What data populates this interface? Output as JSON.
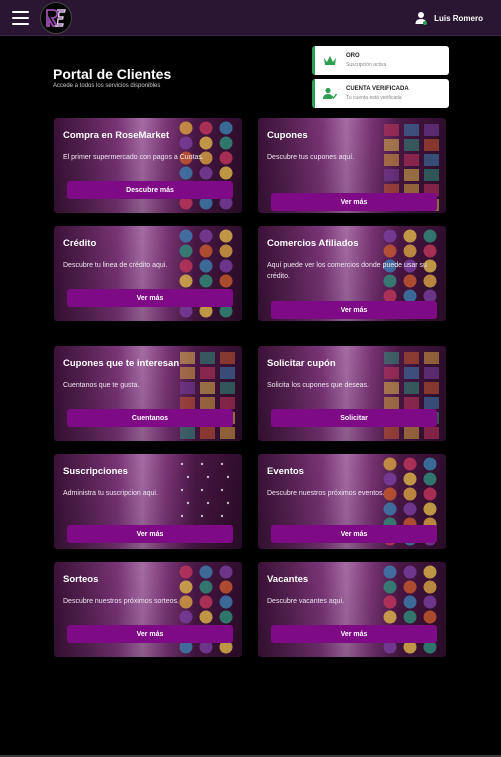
{
  "header": {
    "user_name": "Luis Romero",
    "logo_text": "RE"
  },
  "page": {
    "title": "Portal de Clientes",
    "subtitle": "Accede a todos los servicios disponibles"
  },
  "status": [
    {
      "label": "ORO",
      "sub": "Suscripción activa",
      "icon": "crown-icon"
    },
    {
      "label": "CUENTA VERIFICADA",
      "sub": "Tu cuenta está verificada",
      "icon": "verified-user-icon"
    }
  ],
  "cards": [
    {
      "title": "Compra en RoseMarket",
      "desc": "El primer supermercado con pagos a Cuotas.",
      "button": "Descubre más"
    },
    {
      "title": "Cupones",
      "desc": "Descubre tus cupones aquí.",
      "button": "Ver más"
    },
    {
      "title": "Crédito",
      "desc": "Descubre tu linea de crédito aqui.",
      "button": "Ver más"
    },
    {
      "title": "Comercios Afiliados",
      "desc": "Aquí puede ver los comercios donde puede usar su crédito.",
      "button": "Ver más"
    },
    {
      "title": "Cupones que te interesan",
      "desc": "Cuentanos que te gusta.",
      "button": "Cuentanos"
    },
    {
      "title": "Solicitar cupón",
      "desc": "Solicita los cupones que deseas.",
      "button": "Solicitar"
    },
    {
      "title": "Suscripciones",
      "desc": "Administra tu suscripcion aqui.",
      "button": "Ver más"
    },
    {
      "title": "Eventos",
      "desc": "Descubre nuestros próximos eventos.",
      "button": "Ver más"
    },
    {
      "title": "Sorteos",
      "desc": "Descubre nuestros próximos sorteos.",
      "button": "Ver más"
    },
    {
      "title": "Vacantes",
      "desc": "Descubre vacantes aqui.",
      "button": "Ver más"
    }
  ],
  "colors": {
    "accent": "#7e0a86",
    "topbar": "#2a1533",
    "verified": "#2e9e52"
  }
}
